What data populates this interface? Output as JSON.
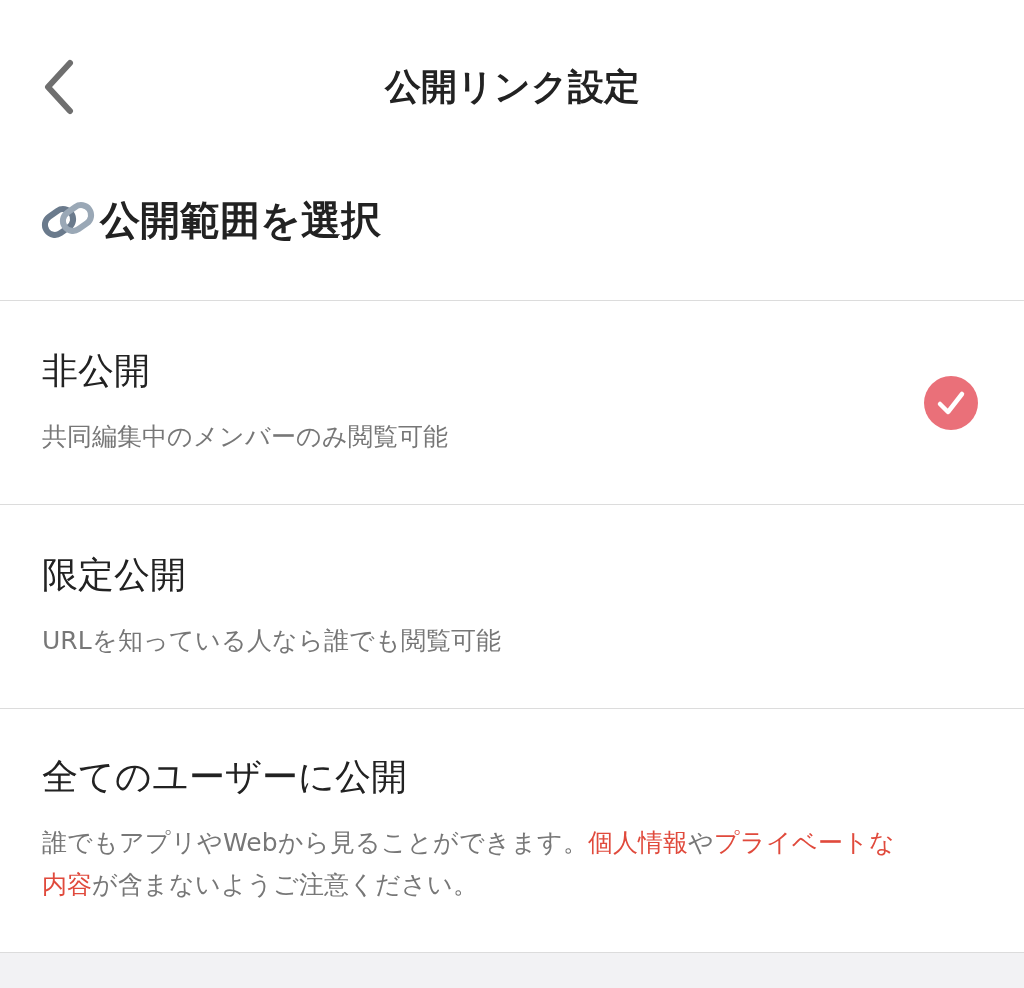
{
  "header": {
    "title": "公開リンク設定"
  },
  "section": {
    "title": "公開範囲を選択"
  },
  "options": [
    {
      "title": "非公開",
      "description": [
        {
          "kind": "text",
          "text": "共同編集中のメンバーのみ閲覧可能"
        }
      ],
      "selected": true
    },
    {
      "title": "限定公開",
      "description": [
        {
          "kind": "text",
          "text": "URLを知っている人なら誰でも閲覧可能"
        }
      ],
      "selected": false
    },
    {
      "title": "全てのユーザーに公開",
      "description": [
        {
          "kind": "text",
          "text": "誰でもアプリやWebから見ることができます。"
        },
        {
          "kind": "warning",
          "text": "個人情報"
        },
        {
          "kind": "text",
          "text": "や"
        },
        {
          "kind": "warning",
          "text": "プライベートな内容"
        },
        {
          "kind": "text",
          "text": "が含まないようご注意ください。"
        }
      ],
      "selected": false
    }
  ]
}
